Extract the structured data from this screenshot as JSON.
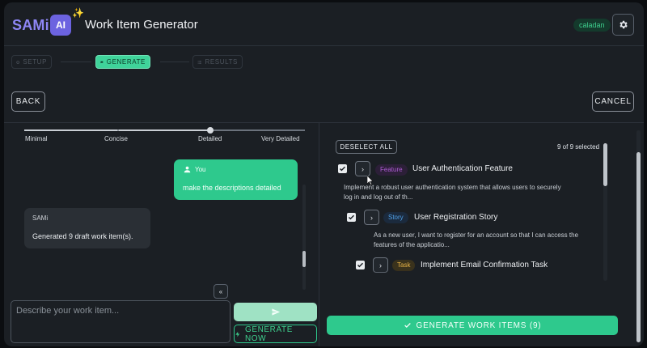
{
  "header": {
    "brand": "SAMi",
    "ai_badge": "AI",
    "sparkle_icon": "sparkle-icon",
    "title": "Work Item Generator",
    "user": "caladan",
    "settings_icon": "gear-icon"
  },
  "stepper": {
    "steps": [
      {
        "label": "SETUP",
        "icon": "gear-icon",
        "active": false
      },
      {
        "label": "GENERATE",
        "icon": "chat-icon",
        "active": true
      },
      {
        "label": "RESULTS",
        "icon": "list-icon",
        "active": false
      }
    ]
  },
  "nav": {
    "back": "BACK",
    "cancel": "CANCEL"
  },
  "detail_slider": {
    "labels": [
      "Minimal",
      "Concise",
      "Detailed",
      "Very Detailed"
    ],
    "value": "Detailed"
  },
  "chat": {
    "messages": [
      {
        "role": "user",
        "sender": "You",
        "icon": "person-icon",
        "text": "make the descriptions detailed"
      },
      {
        "role": "assistant",
        "sender": "SAMi",
        "text": "Generated 9 draft work item(s)."
      }
    ]
  },
  "composer": {
    "placeholder": "Describe your work item...",
    "send_icon": "send-icon",
    "generate_now": "GENERATE NOW",
    "collapse_icon": "chevrons-up-icon"
  },
  "results": {
    "deselect_all": "DESELECT ALL",
    "selected_count": "9 of 9 selected",
    "items": [
      {
        "type": "Feature",
        "title": "User Authentication Feature",
        "checked": true,
        "desc": [
          "Implement a robust user authentication system that allows users to securely",
          "log in and log out of th..."
        ]
      },
      {
        "type": "Story",
        "title": "User Registration Story",
        "checked": true,
        "desc": [
          "As a new user, I want to register for an account so that I can access the",
          "features of the applicatio..."
        ]
      },
      {
        "type": "Task",
        "title": "Implement Email Confirmation Task",
        "checked": true,
        "desc": []
      }
    ],
    "generate_button": "GENERATE WORK ITEMS (9)"
  }
}
